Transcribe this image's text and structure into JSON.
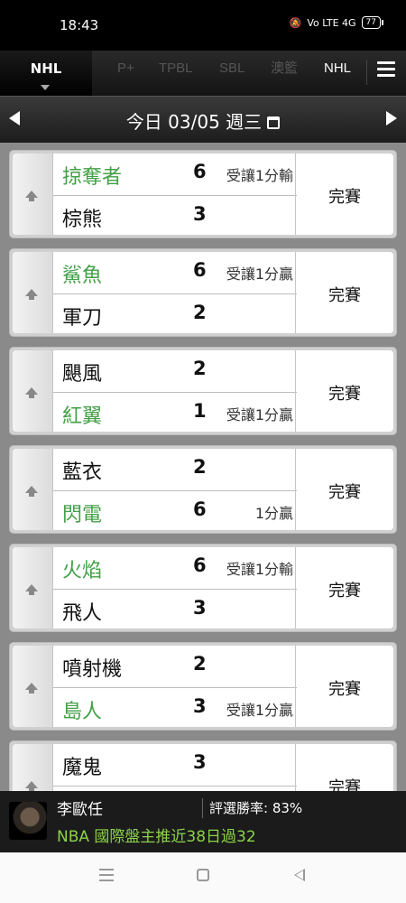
{
  "status_bar": {
    "time": "18:43",
    "signal": "Vo LTE 4G",
    "battery": "77"
  },
  "league_tabs": {
    "active": "NHL",
    "items": [
      "P+",
      "TPBL",
      "SBL",
      "澳籃",
      "NHL"
    ]
  },
  "date_nav": {
    "label": "今日 03/05 週三"
  },
  "games": [
    {
      "home": "掠奪者",
      "home_score": "6",
      "home_win": true,
      "home_odds": "受讓1分輸",
      "away": "棕熊",
      "away_score": "3",
      "away_win": false,
      "away_odds": "",
      "status": "完賽"
    },
    {
      "home": "鯊魚",
      "home_score": "6",
      "home_win": true,
      "home_odds": "受讓1分贏",
      "away": "軍刀",
      "away_score": "2",
      "away_win": false,
      "away_odds": "",
      "status": "完賽"
    },
    {
      "home": "颶風",
      "home_score": "2",
      "home_win": false,
      "home_odds": "",
      "away": "紅翼",
      "away_score": "1",
      "away_win": true,
      "away_odds": "受讓1分贏",
      "status": "完賽"
    },
    {
      "home": "藍衣",
      "home_score": "2",
      "home_win": false,
      "home_odds": "",
      "away": "閃電",
      "away_score": "6",
      "away_win": true,
      "away_odds": "1分贏",
      "status": "完賽"
    },
    {
      "home": "火焰",
      "home_score": "6",
      "home_win": true,
      "home_odds": "受讓1分輸",
      "away": "飛人",
      "away_score": "3",
      "away_win": false,
      "away_odds": "",
      "status": "完賽"
    },
    {
      "home": "噴射機",
      "home_score": "2",
      "home_win": false,
      "home_odds": "",
      "away": "島人",
      "away_score": "3",
      "away_win": true,
      "away_odds": "受讓1分贏",
      "status": "完賽"
    },
    {
      "home": "魔鬼",
      "home_score": "3",
      "home_win": false,
      "home_odds": "",
      "away": "",
      "away_score": "",
      "away_win": false,
      "away_odds": "",
      "status": "完賽"
    }
  ],
  "promo": {
    "name": "李歐任",
    "win_rate": "評選勝率: 83%",
    "headline": "NBA 國際盤主推近38日過32"
  }
}
